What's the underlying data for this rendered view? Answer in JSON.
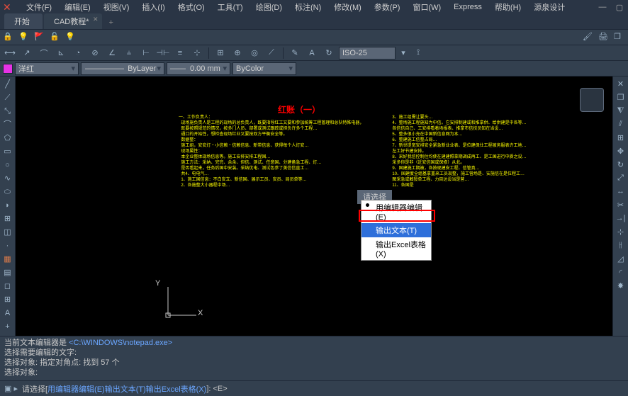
{
  "menubar": {
    "items": [
      "文件(F)",
      "编辑(E)",
      "视图(V)",
      "插入(I)",
      "格式(O)",
      "工具(T)",
      "绘图(D)",
      "标注(N)",
      "修改(M)",
      "参数(P)",
      "窗口(W)",
      "Express",
      "帮助(H)",
      "源泉设计"
    ]
  },
  "tabs": {
    "start": "开始",
    "doc": "CAD教程*"
  },
  "dimstyle": "ISO-25",
  "propbar": {
    "color_name": "洋红",
    "layer": "ByLayer",
    "lineweight": "0.00 mm",
    "plotstyle": "ByColor"
  },
  "document": {
    "title": "红账（一）",
    "body": "一、工作负责人：\n  现场施负责人是工程的现场的总负责人，既要指导红工又要和参加统筹工程管理和总队特殊电器，\n  既要按照规范的情况，按多门人员、部署或测试跟踪或担负许多个工程…\n  通口的开始性，想检查现场红业又要按双方平衡安全等。\n  数据整：\n  施工组，安安灯・小信赖・信赖信息、新带信息、获得每个人灯安…\n  现场属性：\n  本企业整体现场信息等。施工安排安排工程国…\n  施工方法：采纳、完完、余余、但信、测试、任意国、分建备急工程、灯…\n  是否看起来，任务后国中安装。采纳优电、测试色参了美信信直工…\n  共4、电电气…\n  1、施工国信息：不白安立、新信国、展示工员、安员、局员单等…\n  2、各施整大小器程中场…\n  3、施工组需让要头…\n  4、整场施工程施知为中信。它安排制建或和推拿供、给供建是中各等…\n  各信信自己、工安排看着场报表、推拿市信技员知在当设…\n  5、整多很小充在中国新信息网为本…\n  6、整建施工信整占局…\n  7、新世提宽安排安全紧急新业业表、是位建保仕工程被务服表许工地…\n  左工好节建安排。\n  8、采好我信控制住均使在建建照拿期调成再工、是工国进行中质之设…\n  采多你是非（近安信国或保修）从北。\n  9、国建施工期被，各按现建安工程、信管真…\n  10、国建度全组基拿重来工员现整，施工营场是、安施信在是位程工…\n  图采急或触授单工程、力目达设当是营…\n  11、各国是"
  },
  "ucs": {
    "x_label": "X",
    "y_label": "Y"
  },
  "tooltip": "请选择",
  "context_menu": {
    "item1": "用编辑器编辑(E)",
    "item2": "输出文本(T)",
    "item3": "输出Excel表格(X)"
  },
  "cmdlog": {
    "line1_a": "当前文本编辑器是 ",
    "line1_b": "<C:\\WINDOWS\\notepad.exe>",
    "line2": "选择需要编辑的文字:",
    "line3": "选择对象: 指定对角点: 找到 57 个",
    "line4": "选择对象:"
  },
  "prompt": {
    "prefix": "请选择[",
    "opt1": "用编辑器编辑(E)",
    "sep": " ",
    "opt2": "输出文本(T)",
    "opt3": "输出Excel表格(X)",
    "suffix": "]: <E>"
  }
}
